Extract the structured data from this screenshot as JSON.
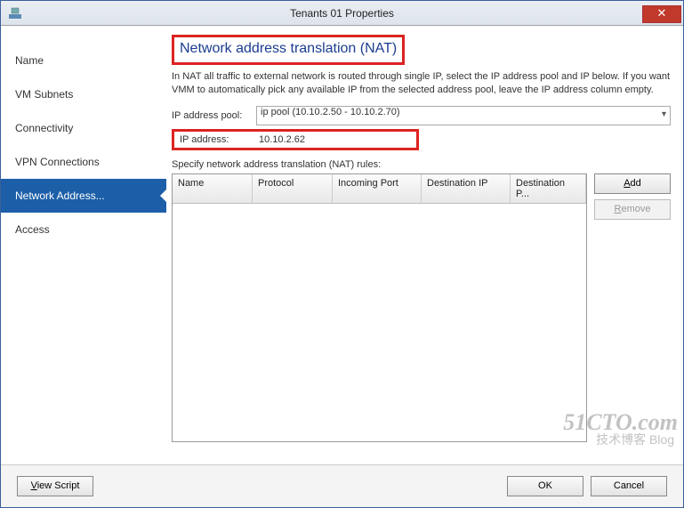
{
  "window": {
    "title": "Tenants 01 Properties"
  },
  "sidebar": {
    "items": [
      {
        "label": "Name"
      },
      {
        "label": "VM Subnets"
      },
      {
        "label": "Connectivity"
      },
      {
        "label": "VPN Connections"
      },
      {
        "label": "Network Address..."
      },
      {
        "label": "Access"
      }
    ],
    "active_index": 4
  },
  "main": {
    "heading": "Network address translation (NAT)",
    "description": "In NAT all traffic to external network is routed through single IP, select the IP address pool and IP below. If you want VMM to automatically pick any available IP from the selected address pool, leave the IP address column empty.",
    "ip_pool_label": "IP address pool:",
    "ip_pool_value": "ip pool (10.10.2.50 - 10.10.2.70)",
    "ip_addr_label": "IP address:",
    "ip_addr_value": "10.10.2.62",
    "rules_label": "Specify network address translation (NAT) rules:",
    "columns": {
      "c1": "Name",
      "c2": "Protocol",
      "c3": "Incoming Port",
      "c4": "Destination IP",
      "c5": "Destination P..."
    },
    "buttons": {
      "add": "Add",
      "remove": "Remove"
    }
  },
  "footer": {
    "view_script": "View Script",
    "ok": "OK",
    "cancel": "Cancel"
  },
  "watermark": {
    "main": "51CTO.com",
    "sub": "技术博客    Blog"
  }
}
